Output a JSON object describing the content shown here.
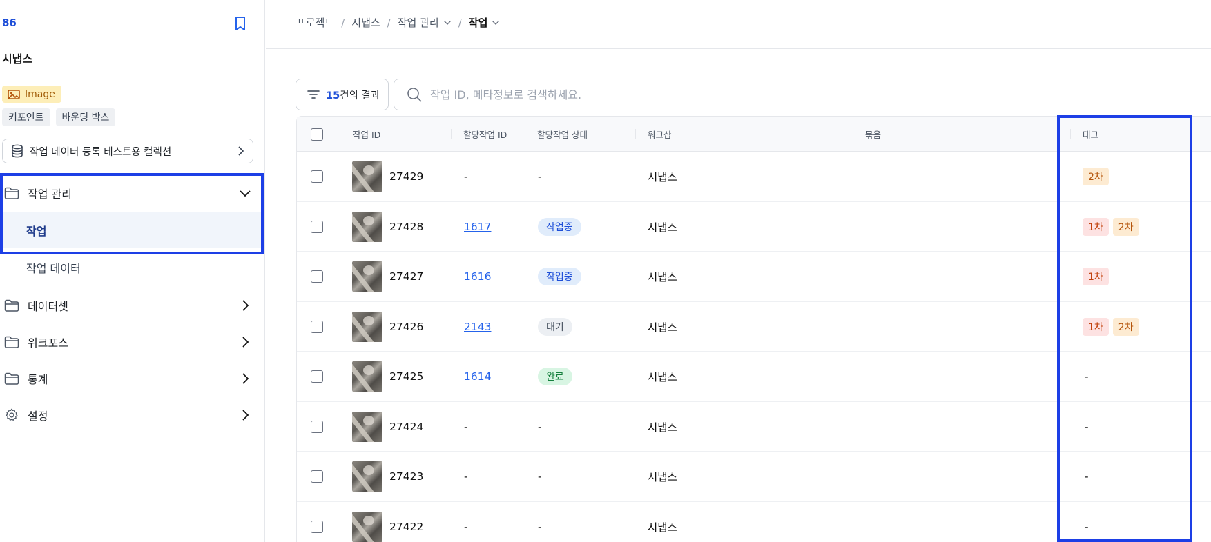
{
  "sidebar": {
    "project_id": "86",
    "project_name": "시냅스",
    "data_type": "Image",
    "annotation_types": [
      "키포인트",
      "바운딩 박스"
    ],
    "collection_label": "작업 데이터 등록 테스트용 컬렉션",
    "nav": {
      "task_mgmt": "작업 관리",
      "task": "작업",
      "task_data": "작업 데이터",
      "dataset": "데이터셋",
      "workforce": "워크포스",
      "stats": "통계",
      "settings": "설정"
    }
  },
  "breadcrumb": [
    "프로젝트",
    "시냅스",
    "작업 관리",
    "작업"
  ],
  "toolbar": {
    "result_count": "15",
    "result_suffix": "건의 결과",
    "search_placeholder": "작업 ID, 메타정보로 검색하세요."
  },
  "table": {
    "columns": [
      "작업 ID",
      "할당작업 ID",
      "할당작업 상태",
      "워크샵",
      "묶음",
      "태그"
    ],
    "rows": [
      {
        "id": "27429",
        "assign_id": "-",
        "status": "-",
        "workshop": "시냅스",
        "tags": [
          "2차"
        ]
      },
      {
        "id": "27428",
        "assign_id": "1617",
        "status": "작업중",
        "workshop": "시냅스",
        "tags": [
          "1차",
          "2차"
        ]
      },
      {
        "id": "27427",
        "assign_id": "1616",
        "status": "작업중",
        "workshop": "시냅스",
        "tags": [
          "1차"
        ]
      },
      {
        "id": "27426",
        "assign_id": "2143",
        "status": "대기",
        "workshop": "시냅스",
        "tags": [
          "1차",
          "2차"
        ]
      },
      {
        "id": "27425",
        "assign_id": "1614",
        "status": "완료",
        "workshop": "시냅스",
        "tags": [
          "-"
        ]
      },
      {
        "id": "27424",
        "assign_id": "-",
        "status": "-",
        "workshop": "시냅스",
        "tags": [
          "-"
        ]
      },
      {
        "id": "27423",
        "assign_id": "-",
        "status": "-",
        "workshop": "시냅스",
        "tags": [
          "-"
        ]
      },
      {
        "id": "27422",
        "assign_id": "-",
        "status": "-",
        "workshop": "시냅스",
        "tags": [
          "-"
        ]
      }
    ]
  },
  "colors": {
    "accent": "#1d4ed8",
    "highlight": "#1d3fe6"
  }
}
